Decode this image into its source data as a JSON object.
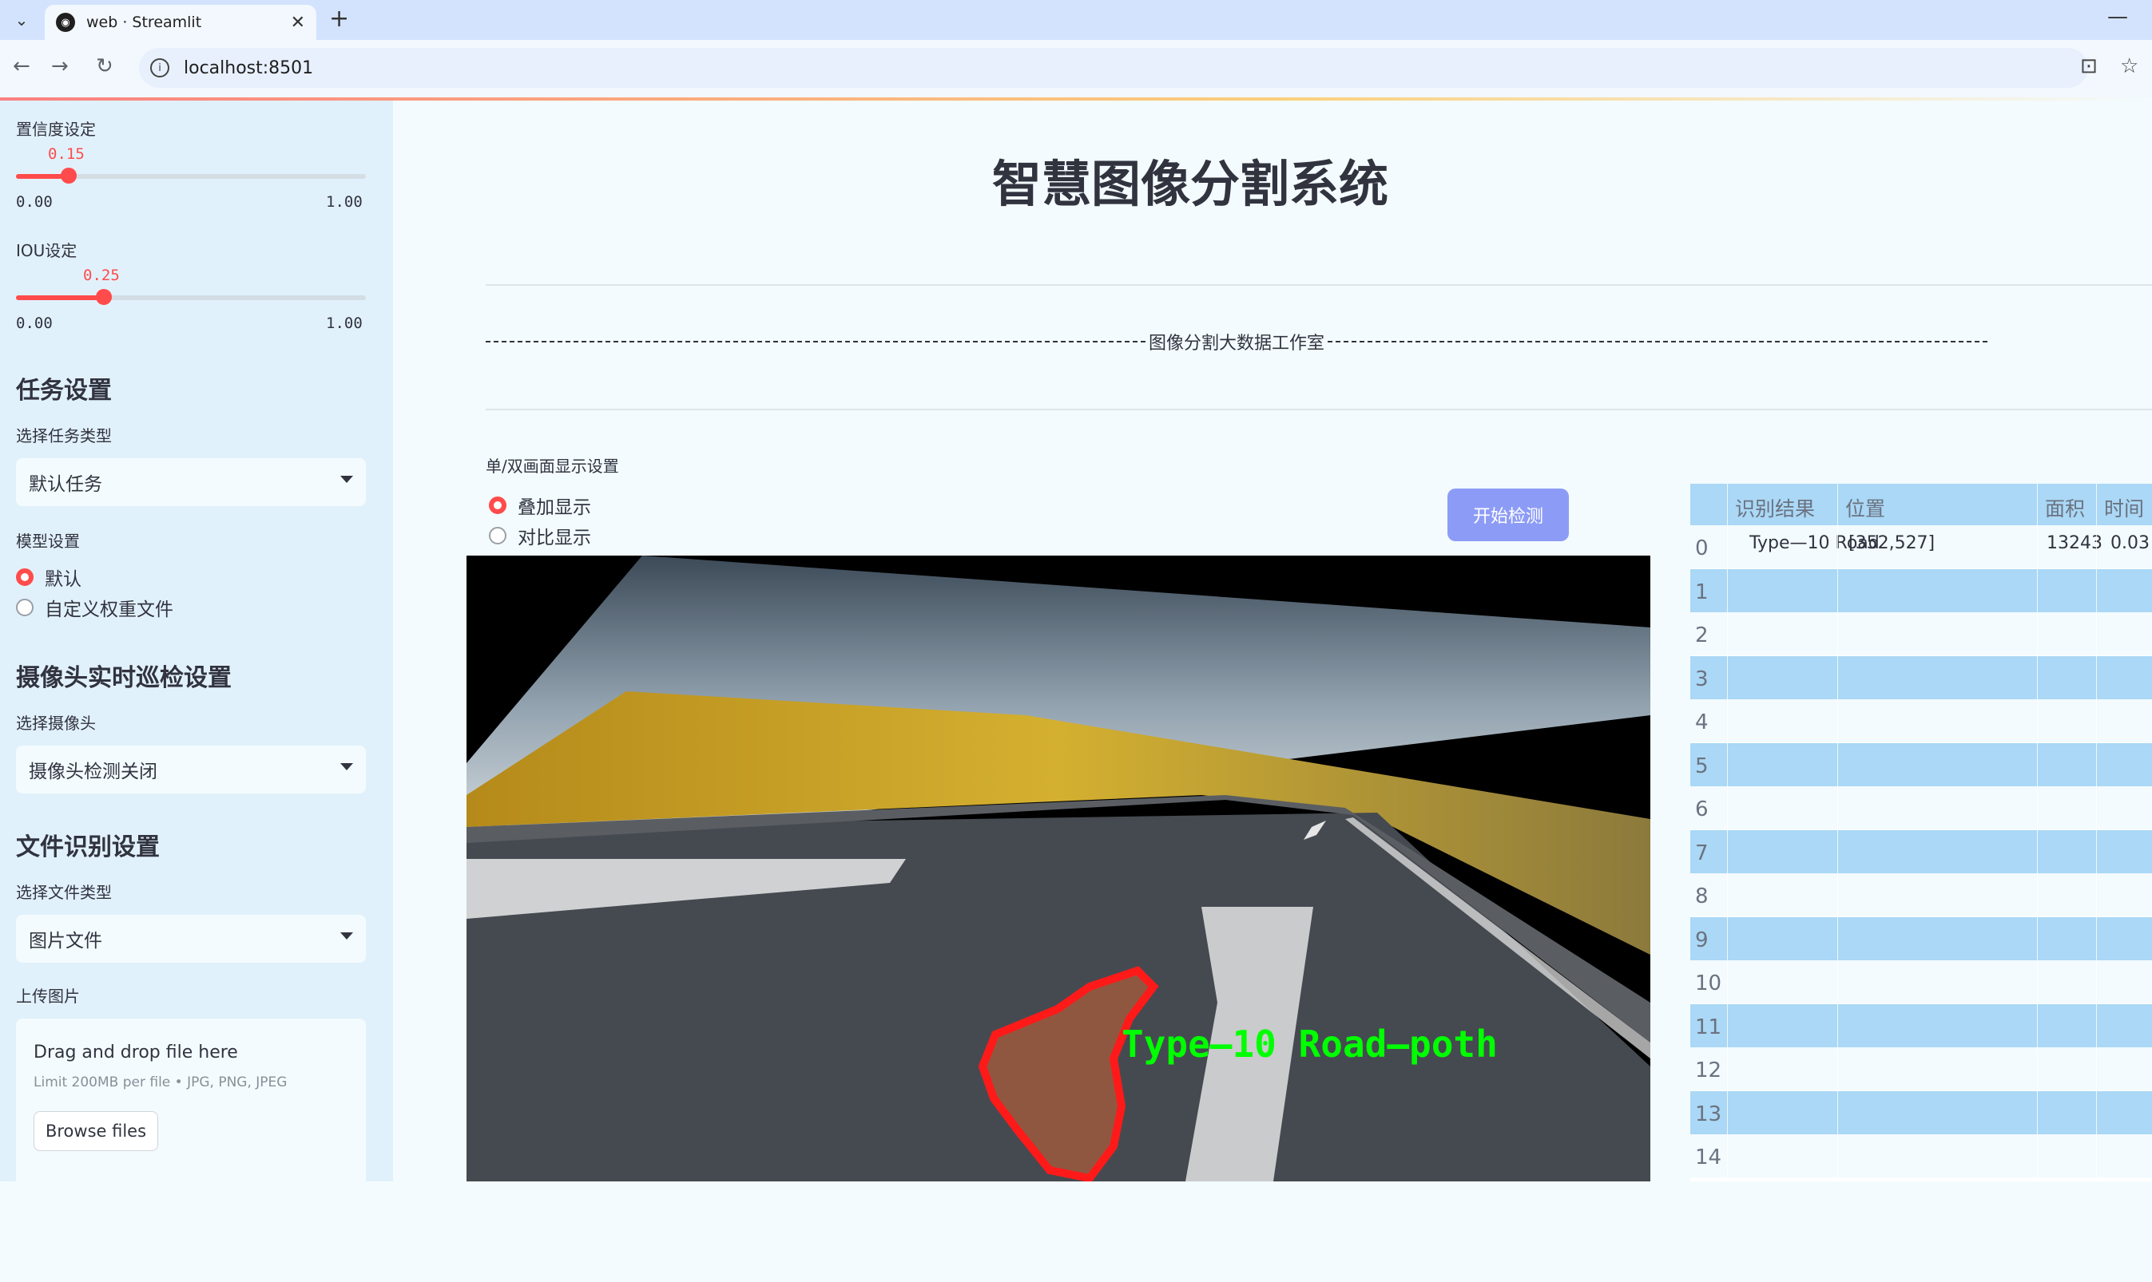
{
  "browser": {
    "tab_title": "web · Streamlit",
    "url": "localhost:8501"
  },
  "sidebar": {
    "confidence": {
      "label": "置信度设定",
      "value": "0.15",
      "value_num": 0.15,
      "min": "0.00",
      "max": "1.00"
    },
    "iou": {
      "label": "IOU设定",
      "value": "0.25",
      "value_num": 0.25,
      "min": "0.00",
      "max": "1.00"
    },
    "task_header": "任务设置",
    "task_type_label": "选择任务类型",
    "task_type_value": "默认任务",
    "model_label": "模型设置",
    "model_options": [
      "默认",
      "自定义权重文件"
    ],
    "model_selected": "默认",
    "camera_header": "摄像头实时巡检设置",
    "camera_label": "选择摄像头",
    "camera_value": "摄像头检测关闭",
    "file_header": "文件识别设置",
    "file_type_label": "选择文件类型",
    "file_type_value": "图片文件",
    "upload_label": "上传图片",
    "dropzone_title": "Drag and drop file here",
    "dropzone_sub": "Limit 200MB per file • JPG, PNG, JPEG",
    "browse_label": "Browse files"
  },
  "main": {
    "title": "智慧图像分割系统",
    "divider_text": "图像分割大数据工作室",
    "display_label": "单/双画面显示设置",
    "display_options": [
      "叠加显示",
      "对比显示"
    ],
    "display_selected": "叠加显示",
    "start_button": "开始检测",
    "detection_label": "Type—10 Road—poth"
  },
  "table": {
    "columns": [
      "",
      "识别结果",
      "位置",
      "面积",
      "时间"
    ],
    "rows": [
      {
        "index": "0",
        "result": "Type—10 Road",
        "position": "[352,527]",
        "area": "13243",
        "time": "0.03"
      },
      {
        "index": "1"
      },
      {
        "index": "2"
      },
      {
        "index": "3"
      },
      {
        "index": "4"
      },
      {
        "index": "5"
      },
      {
        "index": "6"
      },
      {
        "index": "7"
      },
      {
        "index": "8"
      },
      {
        "index": "9"
      },
      {
        "index": "10"
      },
      {
        "index": "11"
      },
      {
        "index": "12"
      },
      {
        "index": "13"
      },
      {
        "index": "14"
      }
    ]
  },
  "colors": {
    "accent": "#ff4b4b",
    "button": "#8c9cf6",
    "table_header": "#aad8f6",
    "sidebar_bg": "#e1f1fb",
    "mask_outline": "#ff1a1a",
    "label_green": "#00ff00"
  }
}
